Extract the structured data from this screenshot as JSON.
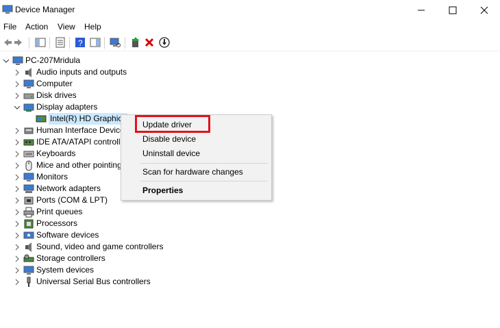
{
  "window": {
    "title": "Device Manager"
  },
  "menu": [
    "File",
    "Action",
    "View",
    "Help"
  ],
  "toolbar": {
    "buttons": [
      "back-arrow-icon",
      "forward-arrow-icon",
      "show-hide-console-tree-icon",
      "properties-icon",
      "help-icon",
      "action-pane-icon",
      "scan-hardware-icon",
      "update-driver-icon",
      "uninstall-icon",
      "disable-icon"
    ]
  },
  "tree": {
    "root": "PC-207Mridula",
    "categories": [
      "Audio inputs and outputs",
      "Computer",
      "Disk drives",
      "Display adapters",
      "Human Interface Device",
      "IDE ATA/ATAPI controller",
      "Keyboards",
      "Mice and other pointing",
      "Monitors",
      "Network adapters",
      "Ports (COM & LPT)",
      "Print queues",
      "Processors",
      "Software devices",
      "Sound, video and game controllers",
      "Storage controllers",
      "System devices",
      "Universal Serial Bus controllers"
    ],
    "expanded_child": "Intel(R) HD Graphics"
  },
  "context_menu": {
    "items": [
      "Update driver",
      "Disable device",
      "Uninstall device",
      "Scan for hardware changes",
      "Properties"
    ]
  },
  "colors": {
    "selection": "#cce8ff",
    "highlight_box": "#e3121b"
  }
}
